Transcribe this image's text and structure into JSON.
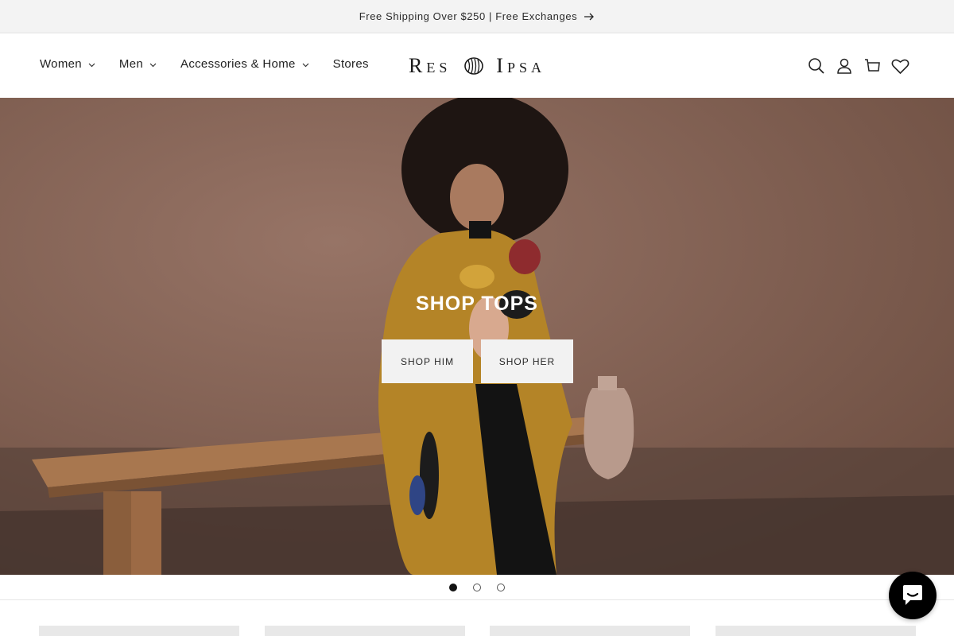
{
  "announcement": {
    "text": "Free Shipping Over $250 | Free Exchanges",
    "icon": "arrow-right-icon"
  },
  "nav": {
    "items": [
      {
        "label": "Women",
        "has_dropdown": true
      },
      {
        "label": "Men",
        "has_dropdown": true
      },
      {
        "label": "Accessories & Home",
        "has_dropdown": true
      },
      {
        "label": "Stores",
        "has_dropdown": false
      }
    ]
  },
  "logo": {
    "word1": "Res",
    "word2": "Ipsa"
  },
  "header_icons": [
    "search-icon",
    "account-icon",
    "cart-icon",
    "wishlist-heart-icon"
  ],
  "hero": {
    "title": "SHOP TOPS",
    "buttons": [
      {
        "label": "SHOP HIM"
      },
      {
        "label": "SHOP HER"
      }
    ]
  },
  "slideshow": {
    "slide_count": 3,
    "active_index": 0
  },
  "chat": {
    "icon": "chat-bubble-icon"
  },
  "colors": {
    "announce_bg": "#f3f3f3",
    "hero_bg": "#7c5a4b",
    "button_bg": "#f2f2f2",
    "chat_bg": "#000000",
    "coat": "#b48427"
  }
}
